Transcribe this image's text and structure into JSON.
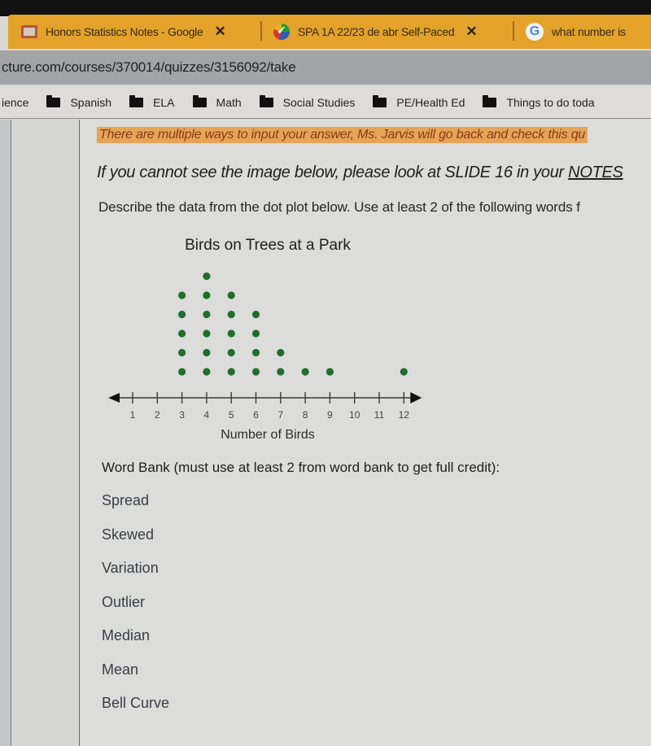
{
  "browser": {
    "tabs": [
      {
        "title": "Honors Statistics Notes - Google",
        "icon": "google-docs-icon",
        "close": "✕"
      },
      {
        "title": "SPA 1A 22/23 de abr Self-Paced",
        "icon": "edpuzzle-icon",
        "close": "✕"
      },
      {
        "title": "what number is",
        "icon": "google-icon",
        "icon_glyph": "G"
      }
    ],
    "url": "cture.com/courses/370014/quizzes/3156092/take",
    "bookmarks": [
      {
        "label": "ience",
        "folder": false
      },
      {
        "label": "Spanish",
        "folder": true
      },
      {
        "label": "ELA",
        "folder": true
      },
      {
        "label": "Math",
        "folder": true
      },
      {
        "label": "Social Studies",
        "folder": true
      },
      {
        "label": "PE/Health Ed",
        "folder": true
      },
      {
        "label": "Things to do toda",
        "folder": true
      }
    ]
  },
  "question": {
    "notice": "There are multiple ways to input your answer, Ms. Jarvis will go back and check this qu",
    "slide_note_prefix": "If you cannot see the image below, please look at SLIDE 16 in your ",
    "slide_note_link": "NOTES",
    "instructions": "Describe the data from the dot plot below.  Use at least 2 of the following words f",
    "word_bank_title": "Word Bank (must use at least 2 from word bank to get full credit):",
    "word_bank": [
      "Spread",
      "Skewed",
      "Variation",
      "Outlier",
      "Median",
      "Mean",
      "Bell Curve"
    ]
  },
  "colors": {
    "tab_strip": "#e3a22a",
    "notice_highlight": "#e6a456",
    "dot": "#1f6e2e"
  },
  "chart_data": {
    "type": "scatter",
    "subtype": "dot-plot",
    "title": "Birds on Trees at a Park",
    "xlabel": "Number of Birds",
    "ylabel": "",
    "x_ticks": [
      1,
      2,
      3,
      4,
      5,
      6,
      7,
      8,
      9,
      10,
      11,
      12
    ],
    "xlim": [
      1,
      12
    ],
    "points": [
      {
        "x": 3,
        "count": 5
      },
      {
        "x": 4,
        "count": 6
      },
      {
        "x": 5,
        "count": 5
      },
      {
        "x": 6,
        "count": 4
      },
      {
        "x": 7,
        "count": 2
      },
      {
        "x": 8,
        "count": 1
      },
      {
        "x": 9,
        "count": 1
      },
      {
        "x": 12,
        "count": 1
      }
    ],
    "total": 25,
    "grid": false,
    "axis_arrows": "both"
  }
}
